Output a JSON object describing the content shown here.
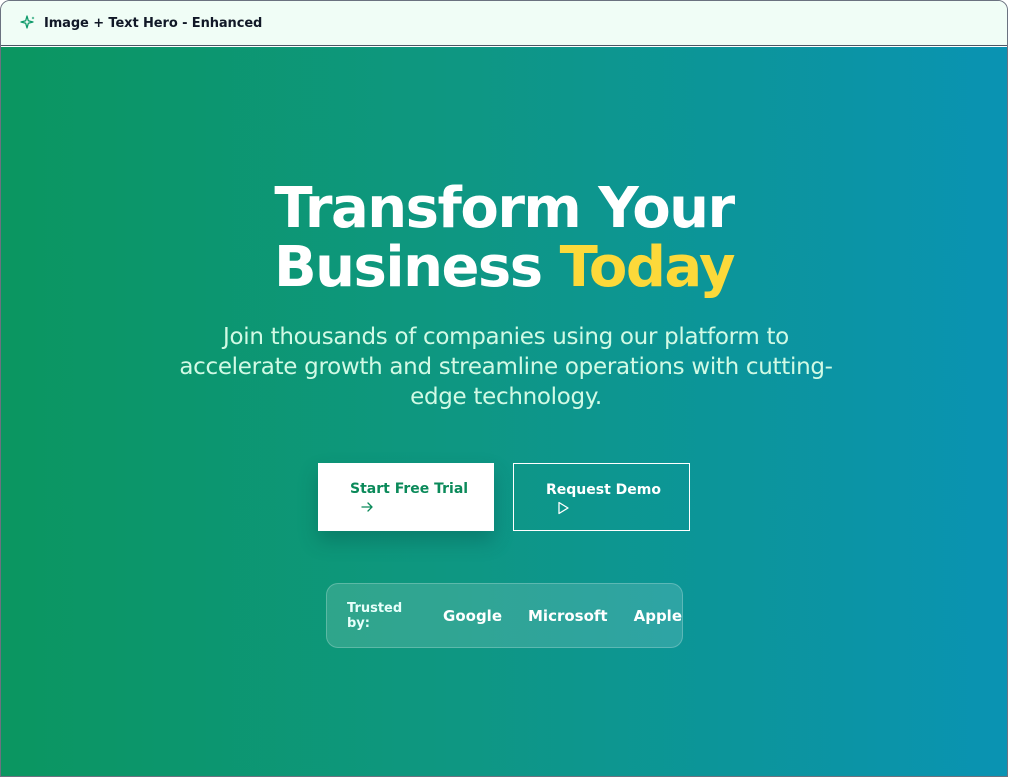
{
  "window": {
    "title": "Image + Text Hero - Enhanced",
    "icon": "sparkle-icon"
  },
  "hero": {
    "headline_line1": "Transform Your",
    "headline_line2_main": "Business",
    "headline_line2_accent": "Today",
    "subtitle": "Join thousands of companies using our platform to accelerate growth and streamline operations with cutting-edge technology.",
    "colors": {
      "gradient_start": "#0b9660",
      "gradient_end": "#0a93b3",
      "accent": "#fcd93a",
      "primary_button_text": "#0b8a5a"
    }
  },
  "buttons": {
    "primary": {
      "label": "Start Free Trial",
      "icon": "arrow-right-icon"
    },
    "secondary": {
      "label": "Request Demo",
      "icon": "play-icon"
    }
  },
  "trust": {
    "label": "Trusted by:",
    "brands": [
      "Google",
      "Microsoft",
      "Apple"
    ]
  }
}
